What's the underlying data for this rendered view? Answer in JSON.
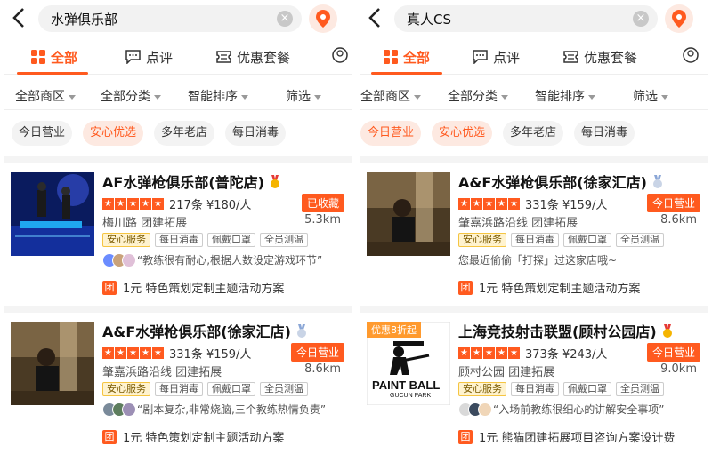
{
  "panels": [
    {
      "search": {
        "query": "水弹俱乐部"
      },
      "tabs": [
        {
          "label": "全部"
        },
        {
          "label": "点评"
        },
        {
          "label": "优惠套餐"
        }
      ],
      "filters": [
        {
          "label": "全部商区"
        },
        {
          "label": "全部分类"
        },
        {
          "label": "智能排序"
        },
        {
          "label": "筛选"
        }
      ],
      "chips": [
        {
          "label": "今日营业"
        },
        {
          "label": "安心优选"
        },
        {
          "label": "多年老店"
        },
        {
          "label": "每日消毒"
        }
      ],
      "results": [
        {
          "title": "AF水弹枪俱乐部(普陀店)",
          "rating_text": "217条 ¥180/人",
          "status": "已收藏",
          "location": "梅川路  团建拓展",
          "distance": "5.3km",
          "tags": [
            "安心服务",
            "每日消毒",
            "佩戴口罩",
            "全员测温"
          ],
          "review": "“教练很有耐心,根据人数设定游戏环节”",
          "deal": "1元 特色策划定制主题活动方案",
          "deal_badge": "团"
        },
        {
          "title": "A&F水弹枪俱乐部(徐家汇店)",
          "rating_text": "331条 ¥159/人",
          "status": "今日营业",
          "location": "肇嘉浜路沿线  团建拓展",
          "distance": "8.6km",
          "tags": [
            "安心服务",
            "每日消毒",
            "佩戴口罩",
            "全员测温"
          ],
          "review": "“剧本复杂,非常烧脑,三个教练热情负责”",
          "deal": "1元 特色策划定制主题活动方案",
          "deal_badge": "团"
        }
      ]
    },
    {
      "search": {
        "query": "真人CS"
      },
      "tabs": [
        {
          "label": "全部"
        },
        {
          "label": "点评"
        },
        {
          "label": "优惠套餐"
        }
      ],
      "filters": [
        {
          "label": "全部商区"
        },
        {
          "label": "全部分类"
        },
        {
          "label": "智能排序"
        },
        {
          "label": "筛选"
        }
      ],
      "chips": [
        {
          "label": "今日营业"
        },
        {
          "label": "安心优选"
        },
        {
          "label": "多年老店"
        },
        {
          "label": "每日消毒"
        }
      ],
      "results": [
        {
          "title": "A&F水弹枪俱乐部(徐家汇店)",
          "rating_text": "331条 ¥159/人",
          "status": "今日营业",
          "location": "肇嘉浜路沿线  团建拓展",
          "distance": "8.6km",
          "tags": [
            "安心服务",
            "每日消毒",
            "佩戴口罩",
            "全员测温"
          ],
          "review": "您最近偷偷「打探」过这家店哦~",
          "deal": "1元 特色策划定制主题活动方案",
          "deal_badge": "团"
        },
        {
          "title": "上海竞技射击联盟(顾村公园店)",
          "rating_text": "373条 ¥243/人",
          "status": "今日营业",
          "location": "顾村公园  团建拓展",
          "distance": "9.0km",
          "tags": [
            "安心服务",
            "每日消毒",
            "佩戴口罩",
            "全员测温"
          ],
          "review": "“入场前教练很细心的讲解安全事项”",
          "deal": "1元 熊猫团建拓展项目咨询方案设计费",
          "deal_badge": "团",
          "image_badge": "优惠8折起",
          "image_text": "PAINT BALL",
          "image_subtext": "GUCUN PARK"
        }
      ]
    }
  ],
  "icons": {
    "back": "chevron-left-icon",
    "clear": "clear-icon",
    "location": "location-pin-icon",
    "grid": "grid-icon",
    "comment": "comment-icon",
    "coupon": "coupon-icon",
    "medal": "medal-icon"
  },
  "colors": {
    "accent": "#ff5a1f",
    "gold": "#f5c542"
  }
}
